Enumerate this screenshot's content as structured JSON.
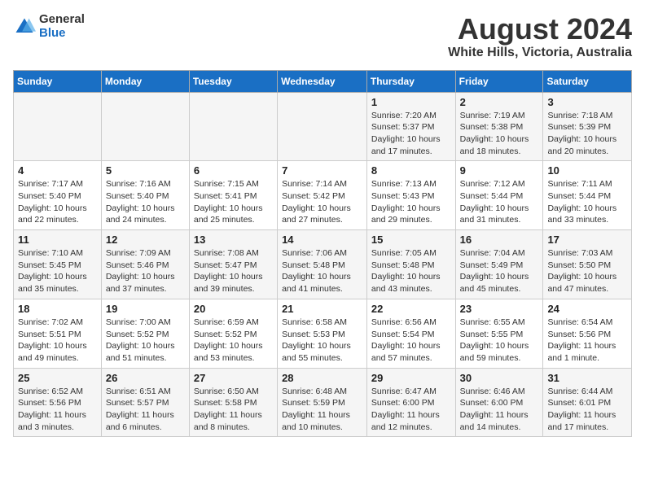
{
  "header": {
    "logo_general": "General",
    "logo_blue": "Blue",
    "main_title": "August 2024",
    "subtitle": "White Hills, Victoria, Australia"
  },
  "days_of_week": [
    "Sunday",
    "Monday",
    "Tuesday",
    "Wednesday",
    "Thursday",
    "Friday",
    "Saturday"
  ],
  "weeks": [
    [
      {
        "date": "",
        "info": ""
      },
      {
        "date": "",
        "info": ""
      },
      {
        "date": "",
        "info": ""
      },
      {
        "date": "",
        "info": ""
      },
      {
        "date": "1",
        "info": "Sunrise: 7:20 AM\nSunset: 5:37 PM\nDaylight: 10 hours\nand 17 minutes."
      },
      {
        "date": "2",
        "info": "Sunrise: 7:19 AM\nSunset: 5:38 PM\nDaylight: 10 hours\nand 18 minutes."
      },
      {
        "date": "3",
        "info": "Sunrise: 7:18 AM\nSunset: 5:39 PM\nDaylight: 10 hours\nand 20 minutes."
      }
    ],
    [
      {
        "date": "4",
        "info": "Sunrise: 7:17 AM\nSunset: 5:40 PM\nDaylight: 10 hours\nand 22 minutes."
      },
      {
        "date": "5",
        "info": "Sunrise: 7:16 AM\nSunset: 5:40 PM\nDaylight: 10 hours\nand 24 minutes."
      },
      {
        "date": "6",
        "info": "Sunrise: 7:15 AM\nSunset: 5:41 PM\nDaylight: 10 hours\nand 25 minutes."
      },
      {
        "date": "7",
        "info": "Sunrise: 7:14 AM\nSunset: 5:42 PM\nDaylight: 10 hours\nand 27 minutes."
      },
      {
        "date": "8",
        "info": "Sunrise: 7:13 AM\nSunset: 5:43 PM\nDaylight: 10 hours\nand 29 minutes."
      },
      {
        "date": "9",
        "info": "Sunrise: 7:12 AM\nSunset: 5:44 PM\nDaylight: 10 hours\nand 31 minutes."
      },
      {
        "date": "10",
        "info": "Sunrise: 7:11 AM\nSunset: 5:44 PM\nDaylight: 10 hours\nand 33 minutes."
      }
    ],
    [
      {
        "date": "11",
        "info": "Sunrise: 7:10 AM\nSunset: 5:45 PM\nDaylight: 10 hours\nand 35 minutes."
      },
      {
        "date": "12",
        "info": "Sunrise: 7:09 AM\nSunset: 5:46 PM\nDaylight: 10 hours\nand 37 minutes."
      },
      {
        "date": "13",
        "info": "Sunrise: 7:08 AM\nSunset: 5:47 PM\nDaylight: 10 hours\nand 39 minutes."
      },
      {
        "date": "14",
        "info": "Sunrise: 7:06 AM\nSunset: 5:48 PM\nDaylight: 10 hours\nand 41 minutes."
      },
      {
        "date": "15",
        "info": "Sunrise: 7:05 AM\nSunset: 5:48 PM\nDaylight: 10 hours\nand 43 minutes."
      },
      {
        "date": "16",
        "info": "Sunrise: 7:04 AM\nSunset: 5:49 PM\nDaylight: 10 hours\nand 45 minutes."
      },
      {
        "date": "17",
        "info": "Sunrise: 7:03 AM\nSunset: 5:50 PM\nDaylight: 10 hours\nand 47 minutes."
      }
    ],
    [
      {
        "date": "18",
        "info": "Sunrise: 7:02 AM\nSunset: 5:51 PM\nDaylight: 10 hours\nand 49 minutes."
      },
      {
        "date": "19",
        "info": "Sunrise: 7:00 AM\nSunset: 5:52 PM\nDaylight: 10 hours\nand 51 minutes."
      },
      {
        "date": "20",
        "info": "Sunrise: 6:59 AM\nSunset: 5:52 PM\nDaylight: 10 hours\nand 53 minutes."
      },
      {
        "date": "21",
        "info": "Sunrise: 6:58 AM\nSunset: 5:53 PM\nDaylight: 10 hours\nand 55 minutes."
      },
      {
        "date": "22",
        "info": "Sunrise: 6:56 AM\nSunset: 5:54 PM\nDaylight: 10 hours\nand 57 minutes."
      },
      {
        "date": "23",
        "info": "Sunrise: 6:55 AM\nSunset: 5:55 PM\nDaylight: 10 hours\nand 59 minutes."
      },
      {
        "date": "24",
        "info": "Sunrise: 6:54 AM\nSunset: 5:56 PM\nDaylight: 11 hours\nand 1 minute."
      }
    ],
    [
      {
        "date": "25",
        "info": "Sunrise: 6:52 AM\nSunset: 5:56 PM\nDaylight: 11 hours\nand 3 minutes."
      },
      {
        "date": "26",
        "info": "Sunrise: 6:51 AM\nSunset: 5:57 PM\nDaylight: 11 hours\nand 6 minutes."
      },
      {
        "date": "27",
        "info": "Sunrise: 6:50 AM\nSunset: 5:58 PM\nDaylight: 11 hours\nand 8 minutes."
      },
      {
        "date": "28",
        "info": "Sunrise: 6:48 AM\nSunset: 5:59 PM\nDaylight: 11 hours\nand 10 minutes."
      },
      {
        "date": "29",
        "info": "Sunrise: 6:47 AM\nSunset: 6:00 PM\nDaylight: 11 hours\nand 12 minutes."
      },
      {
        "date": "30",
        "info": "Sunrise: 6:46 AM\nSunset: 6:00 PM\nDaylight: 11 hours\nand 14 minutes."
      },
      {
        "date": "31",
        "info": "Sunrise: 6:44 AM\nSunset: 6:01 PM\nDaylight: 11 hours\nand 17 minutes."
      }
    ]
  ]
}
